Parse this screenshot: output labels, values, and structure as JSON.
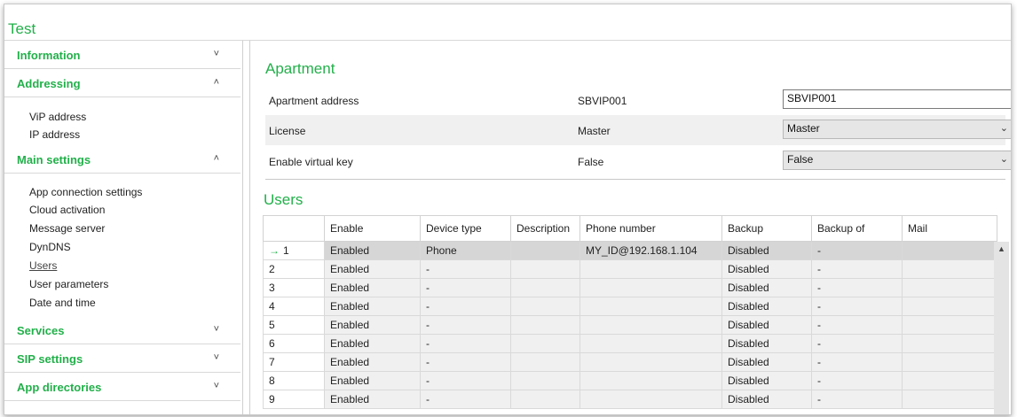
{
  "window": {
    "title": "Test"
  },
  "sidebar": {
    "sections": [
      {
        "label": "Information",
        "chevron": "˅"
      },
      {
        "label": "Addressing",
        "chevron": "˄",
        "items": [
          "ViP address",
          "IP address"
        ]
      },
      {
        "label": "Main settings",
        "chevron": "˄",
        "items": [
          "App connection settings",
          "Cloud activation",
          "Message server",
          "DynDNS",
          "Users",
          "User parameters",
          "Date and time"
        ]
      },
      {
        "label": "Services",
        "chevron": "˅"
      },
      {
        "label": "SIP settings",
        "chevron": "˅"
      },
      {
        "label": "App directories",
        "chevron": "˅"
      }
    ]
  },
  "apartment": {
    "heading": "Apartment",
    "rows": [
      {
        "key": "Apartment address",
        "value": "SBVIP001",
        "control": "SBVIP001"
      },
      {
        "key": "License",
        "value": "Master",
        "control": "Master"
      },
      {
        "key": "Enable virtual key",
        "value": "False",
        "control": "False"
      }
    ]
  },
  "users": {
    "heading": "Users",
    "columns": [
      "",
      "Enable",
      "Device type",
      "Description",
      "Phone number",
      "Backup",
      "Backup of",
      "Mail"
    ],
    "rows": [
      {
        "n": "1",
        "enable": "Enabled",
        "device": "Phone",
        "desc": "",
        "phone": "MY_ID@192.168.1.104",
        "backup": "Disabled",
        "backupof": "-",
        "mail": "",
        "current": "→"
      },
      {
        "n": "2",
        "enable": "Enabled",
        "device": "-",
        "desc": "",
        "phone": "",
        "backup": "Disabled",
        "backupof": "-",
        "mail": ""
      },
      {
        "n": "3",
        "enable": "Enabled",
        "device": "-",
        "desc": "",
        "phone": "",
        "backup": "Disabled",
        "backupof": "-",
        "mail": ""
      },
      {
        "n": "4",
        "enable": "Enabled",
        "device": "-",
        "desc": "",
        "phone": "",
        "backup": "Disabled",
        "backupof": "-",
        "mail": ""
      },
      {
        "n": "5",
        "enable": "Enabled",
        "device": "-",
        "desc": "",
        "phone": "",
        "backup": "Disabled",
        "backupof": "-",
        "mail": ""
      },
      {
        "n": "6",
        "enable": "Enabled",
        "device": "-",
        "desc": "",
        "phone": "",
        "backup": "Disabled",
        "backupof": "-",
        "mail": ""
      },
      {
        "n": "7",
        "enable": "Enabled",
        "device": "-",
        "desc": "",
        "phone": "",
        "backup": "Disabled",
        "backupof": "-",
        "mail": ""
      },
      {
        "n": "8",
        "enable": "Enabled",
        "device": "-",
        "desc": "",
        "phone": "",
        "backup": "Disabled",
        "backupof": "-",
        "mail": ""
      },
      {
        "n": "9",
        "enable": "Enabled",
        "device": "-",
        "desc": "",
        "phone": "",
        "backup": "Disabled",
        "backupof": "-",
        "mail": ""
      }
    ]
  },
  "dropdown_glyph": "⌄",
  "scroll_up_glyph": "▲",
  "accent_color": "#22b04a"
}
